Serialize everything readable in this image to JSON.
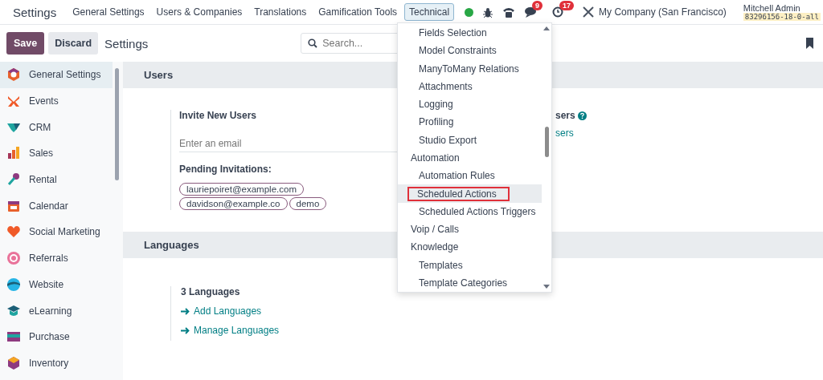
{
  "navbar": {
    "app_title": "Settings",
    "menu": [
      {
        "label": "General Settings",
        "selected": false
      },
      {
        "label": "Users & Companies",
        "selected": false
      },
      {
        "label": "Translations",
        "selected": false
      },
      {
        "label": "Gamification Tools",
        "selected": false
      },
      {
        "label": "Technical",
        "selected": true
      }
    ],
    "messages_badge": "9",
    "activities_badge": "17",
    "company": "My Company (San Francisco)",
    "user": "Mitchell Admin",
    "database": "83296156-18-0-all"
  },
  "control_bar": {
    "buttons": [
      "Save",
      "Discard"
    ],
    "title": "Settings",
    "search": {
      "placeholder": "Search..."
    }
  },
  "sidebar": {
    "items": [
      {
        "label": "General Settings",
        "selected": true
      },
      {
        "label": "Events",
        "selected": false
      },
      {
        "label": "CRM",
        "selected": false
      },
      {
        "label": "Sales",
        "selected": false
      },
      {
        "label": "Rental",
        "selected": false
      },
      {
        "label": "Calendar",
        "selected": false
      },
      {
        "label": "Social Marketing",
        "selected": false
      },
      {
        "label": "Referrals",
        "selected": false
      },
      {
        "label": "Website",
        "selected": false
      },
      {
        "label": "eLearning",
        "selected": false
      },
      {
        "label": "Purchase",
        "selected": false
      },
      {
        "label": "Inventory",
        "selected": false
      }
    ]
  },
  "users_section": {
    "title": "Users",
    "invite_label": "Invite New Users",
    "email": {
      "placeholder": "Enter an email"
    },
    "pending_label": "Pending Invitations:",
    "invitations": [
      "lauriepoiret@example.com",
      "davidson@example.co",
      "demo"
    ],
    "right_label": "sers",
    "right_link": "sers"
  },
  "languages_section": {
    "title": "Languages",
    "count": "3 Languages",
    "links": [
      "Add Languages",
      "Manage Languages"
    ]
  },
  "dropdown": {
    "items": [
      {
        "kind": "item",
        "label": "Fields Selection",
        "selected": false
      },
      {
        "kind": "item",
        "label": "Model Constraints",
        "selected": false
      },
      {
        "kind": "item",
        "label": "ManyToMany Relations",
        "selected": false
      },
      {
        "kind": "item",
        "label": "Attachments",
        "selected": false
      },
      {
        "kind": "item",
        "label": "Logging",
        "selected": false
      },
      {
        "kind": "item",
        "label": "Profiling",
        "selected": false
      },
      {
        "kind": "item",
        "label": "Studio Export",
        "selected": false
      },
      {
        "kind": "header",
        "label": "Automation",
        "selected": false
      },
      {
        "kind": "item",
        "label": "Automation Rules",
        "selected": false
      },
      {
        "kind": "item",
        "label": "Scheduled Actions",
        "selected": true
      },
      {
        "kind": "item",
        "label": "Scheduled Actions Triggers",
        "selected": false
      },
      {
        "kind": "header",
        "label": "Voip / Calls",
        "selected": false
      },
      {
        "kind": "header",
        "label": "Knowledge",
        "selected": false
      },
      {
        "kind": "item",
        "label": "Templates",
        "selected": false
      },
      {
        "kind": "item",
        "label": "Template Categories",
        "selected": false
      }
    ]
  }
}
